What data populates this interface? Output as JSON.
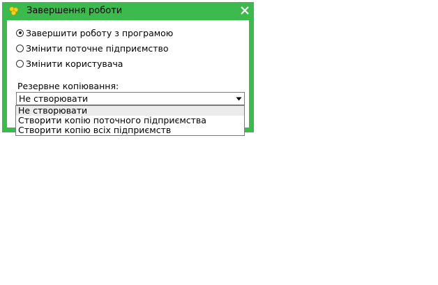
{
  "window": {
    "title": "Завершення роботи",
    "icon": "app-flower-icon",
    "close_icon": "close-icon",
    "accent_color": "#3dba4e"
  },
  "options": [
    {
      "label": "Завершити роботу з програмою",
      "checked": true
    },
    {
      "label": "Змінити поточне підприємство",
      "checked": false
    },
    {
      "label": "Змінити користувача",
      "checked": false
    }
  ],
  "backup": {
    "label": "Резервне копіювання:",
    "selected": "Не створювати",
    "options": [
      "Не створювати",
      "Створити копію поточного підприємства",
      "Створити копію всіх підприємств"
    ]
  }
}
